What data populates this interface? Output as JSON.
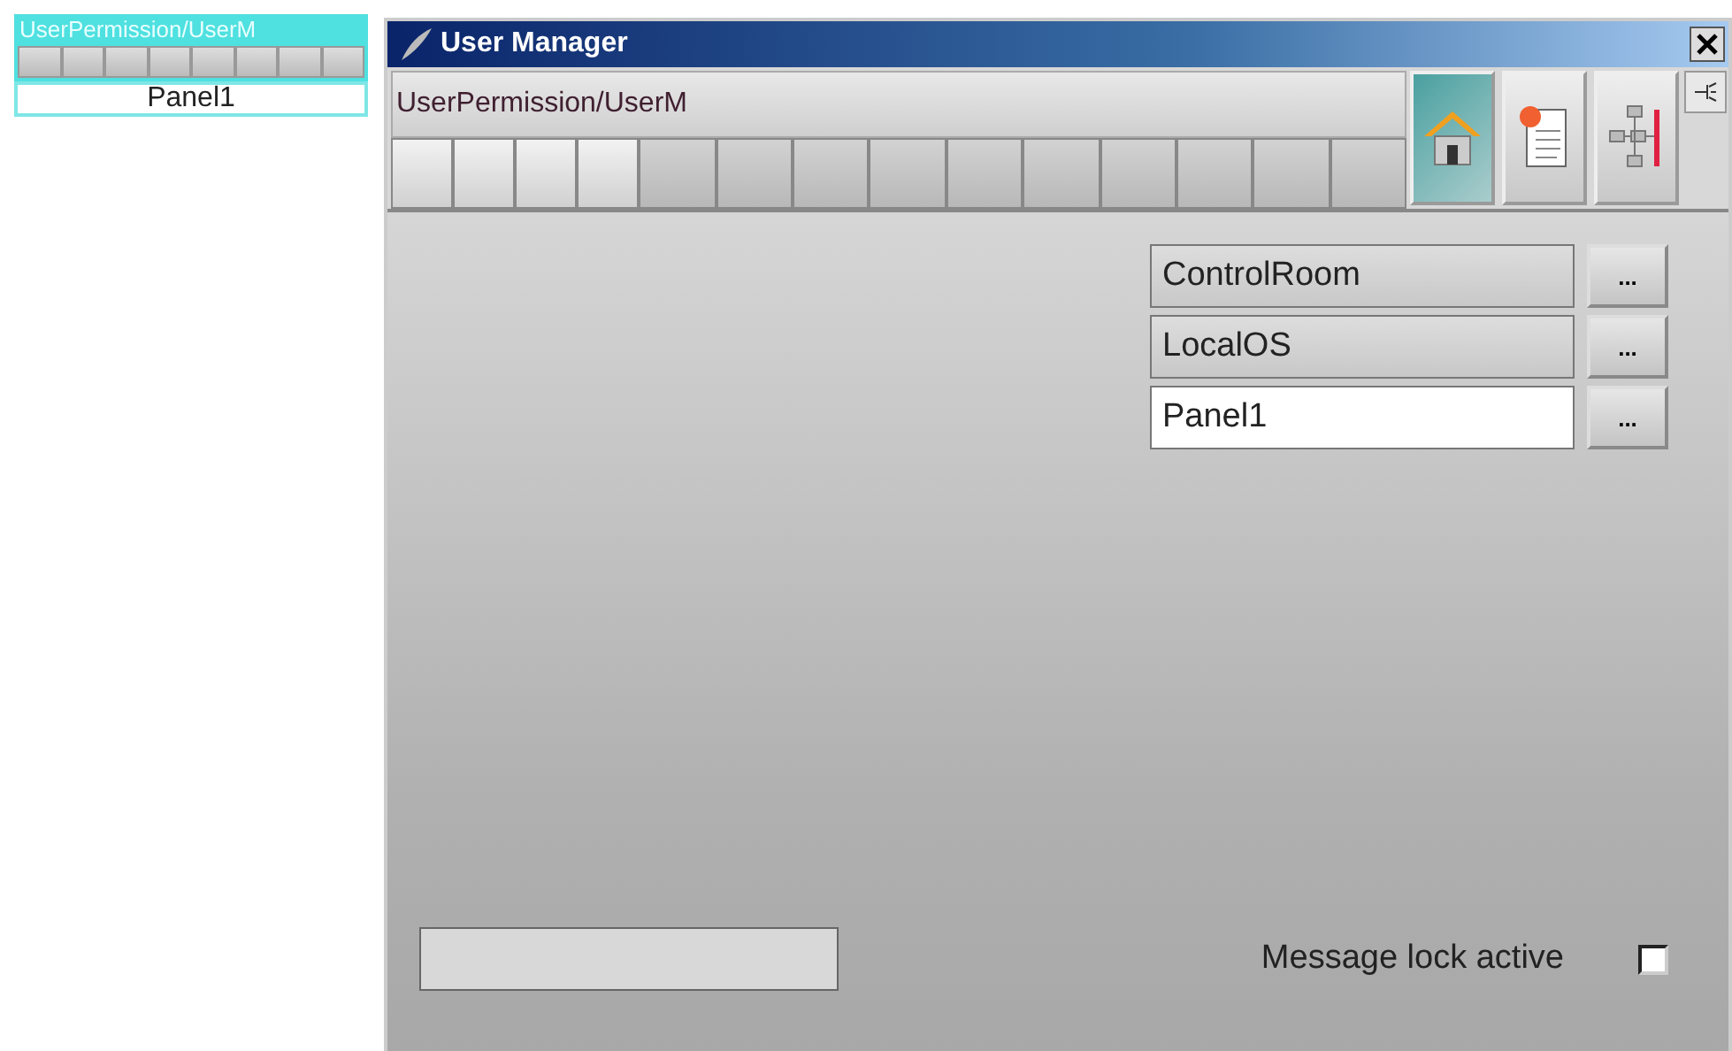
{
  "mini_widget": {
    "title": "UserPermission/UserM",
    "segment_count_cells": [
      {},
      {},
      {},
      {},
      {},
      {},
      {},
      {}
    ],
    "label": "Panel1"
  },
  "window": {
    "title": "User Manager"
  },
  "header": {
    "path": "UserPermission/UserM",
    "segments": [
      {
        "lit": true
      },
      {
        "lit": true
      },
      {
        "lit": true
      },
      {
        "lit": true
      },
      {
        "lit": false
      },
      {
        "lit": false
      },
      {
        "lit": false
      },
      {
        "lit": false
      },
      {
        "lit": false
      },
      {
        "lit": false
      },
      {
        "lit": false
      },
      {
        "lit": false
      },
      {
        "lit": false
      },
      {
        "lit": false
      }
    ],
    "tools": [
      {
        "kind": "home",
        "selected": true
      },
      {
        "kind": "scroll",
        "selected": false
      },
      {
        "kind": "network",
        "selected": false
      }
    ]
  },
  "items": [
    {
      "label": "ControlRoom",
      "selected": false,
      "button": "..."
    },
    {
      "label": "LocalOS",
      "selected": false,
      "button": "..."
    },
    {
      "label": "Panel1",
      "selected": true,
      "button": "..."
    }
  ],
  "message_lock": {
    "label": "Message lock active",
    "checked": false
  }
}
